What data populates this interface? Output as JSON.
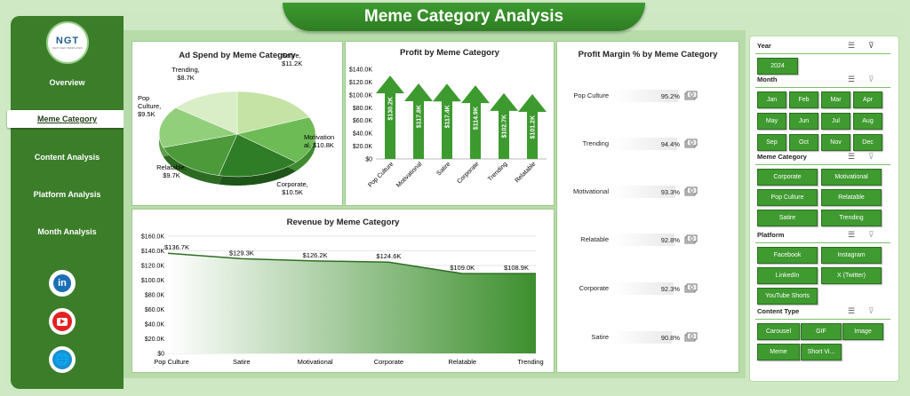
{
  "title": "Meme Category Analysis",
  "logo": {
    "text": "NGT",
    "subtext": "NEXT GEN TEMPLATES"
  },
  "nav": [
    {
      "label": "Overview",
      "active": false
    },
    {
      "label": "Meme Category",
      "active": true
    },
    {
      "label": "Content Analysis",
      "active": false
    },
    {
      "label": "Platform Analysis",
      "active": false
    },
    {
      "label": "Month Analysis",
      "active": false
    }
  ],
  "social": {
    "linkedin": "in",
    "globe": "🌐"
  },
  "colors": {
    "sidebar": "#3c7d2a",
    "accent": "#3f9a30",
    "dark_green": "#2e7d22"
  },
  "chart_data": [
    {
      "type": "pie",
      "title": "Ad Spend by Meme Category",
      "slices": [
        {
          "label": "Satire,",
          "value_label": "$11.2K",
          "value": 11.2
        },
        {
          "label": "Motivation al,",
          "value_label": "$10.8K",
          "value": 10.8
        },
        {
          "label": "Corporate,",
          "value_label": "$10.5K",
          "value": 10.5
        },
        {
          "label": "Relatable,",
          "value_label": "$9.7K",
          "value": 9.7
        },
        {
          "label": "Pop Culture,",
          "value_label": "$9.5K",
          "value": 9.5
        },
        {
          "label": "Trending,",
          "value_label": "$8.7K",
          "value": 8.7
        }
      ]
    },
    {
      "type": "bar",
      "title": "Profit by Meme Category",
      "categories": [
        "Pop Culture",
        "Motivational",
        "Satire",
        "Corporate",
        "Trending",
        "Relatable"
      ],
      "values": [
        130.2,
        117.8,
        117.4,
        114.9,
        102.7,
        101.2
      ],
      "value_labels": [
        "$130.2K",
        "$117.8K",
        "$117.4K",
        "$114.9K",
        "$102.7K",
        "$101.2K"
      ],
      "ylim": [
        0,
        140
      ],
      "yticks": [
        "$0",
        "$20.0K",
        "$40.0K",
        "$60.0K",
        "$80.0K",
        "$100.0K",
        "$120.0K",
        "$140.0K"
      ]
    },
    {
      "type": "area",
      "title": "Revenue by Meme Category",
      "categories": [
        "Pop Culture",
        "Satire",
        "Motivational",
        "Corporate",
        "Relatable",
        "Trending"
      ],
      "values": [
        136.7,
        129.3,
        126.2,
        124.6,
        109.0,
        108.9
      ],
      "value_labels": [
        "$136.7K",
        "$129.3K",
        "$126.2K",
        "$124.6K",
        "$109.0K",
        "$108.9K"
      ],
      "ylim": [
        0,
        160
      ],
      "yticks": [
        "$0",
        "$20.0K",
        "$40.0K",
        "$60.0K",
        "$80.0K",
        "$100.0K",
        "$120.0K",
        "$140.0K",
        "$160.0K"
      ]
    },
    {
      "type": "bar",
      "title": "Profit Margin % by Meme Category",
      "categories": [
        "Pop Culture",
        "Trending",
        "Motivational",
        "Relatable",
        "Corporate",
        "Satire"
      ],
      "values": [
        95.2,
        94.4,
        93.3,
        92.8,
        92.3,
        90.8
      ],
      "value_labels": [
        "95.2%",
        "94.4%",
        "93.3%",
        "92.8%",
        "92.3%",
        "90.8%"
      ]
    }
  ],
  "slicers": {
    "year": {
      "label": "Year",
      "items": [
        "2024"
      ]
    },
    "month": {
      "label": "Month",
      "items": [
        "Jan",
        "Feb",
        "Mar",
        "Apr",
        "May",
        "Jun",
        "Jul",
        "Aug",
        "Sep",
        "Oct",
        "Nov",
        "Dec"
      ]
    },
    "category": {
      "label": "Meme Category",
      "items": [
        "Corporate",
        "Motivational",
        "Pop Culture",
        "Relatable",
        "Satire",
        "Trending"
      ]
    },
    "platform": {
      "label": "Platform",
      "items": [
        "Facebook",
        "Instagram",
        "LinkedIn",
        "X (Twitter)",
        "YouTube Shorts"
      ]
    },
    "content": {
      "label": "Content Type",
      "items": [
        "Carousel",
        "GIF",
        "Image",
        "Meme",
        "Short Vi..."
      ]
    }
  }
}
